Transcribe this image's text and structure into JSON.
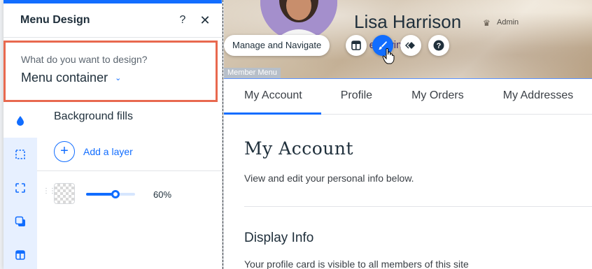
{
  "panel": {
    "title": "Menu Design",
    "help_label": "?",
    "close_label": "✕",
    "design_question": "What do you want to design?",
    "design_target": "Menu container",
    "section_title": "Background fills",
    "add_layer": "Add a layer",
    "layer": {
      "opacity_label": "60%",
      "opacity": 0.6
    }
  },
  "rail": {
    "items": [
      "fill-icon",
      "border-icon",
      "corners-icon",
      "shadow-icon",
      "layout-icon"
    ]
  },
  "canvas": {
    "user": {
      "name": "Lisa Harrison",
      "role": "Admin",
      "follow_text": "Fo      e      lowing"
    },
    "toolbar": {
      "manage_label": "Manage and Navigate"
    },
    "element_label": "Member Menu",
    "tabs": [
      "My Account",
      "Profile",
      "My Orders",
      "My Addresses"
    ],
    "page": {
      "title": "My Account",
      "subtitle": "View and edit your personal info below.",
      "section_title": "Display Info",
      "section_subtitle": "Your profile card is visible to all members of this site"
    }
  },
  "colors": {
    "accent": "#116dff",
    "highlight_border": "#e8694f",
    "rail_bg": "#e7f0ff",
    "avatar_bg": "#a48fcc"
  }
}
